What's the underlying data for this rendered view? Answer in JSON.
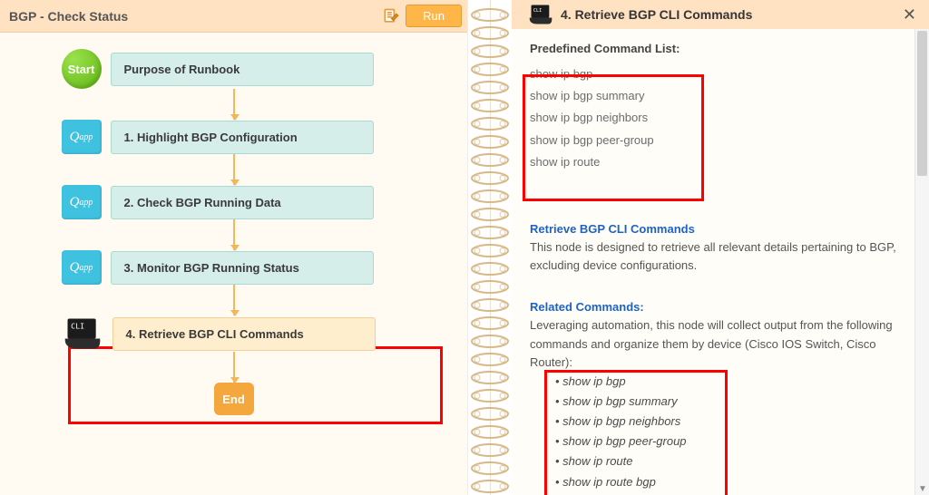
{
  "left": {
    "title": "BGP - Check Status",
    "run_label": "Run",
    "start_label": "Start",
    "end_label": "End",
    "qapp_label": "Q",
    "qapp_sub": "app",
    "nodes": {
      "n0": "Purpose of Runbook",
      "n1": "1. Highlight BGP Configuration",
      "n2": "2. Check BGP Running Data",
      "n3": "3. Monitor BGP Running Status",
      "n4": "4. Retrieve BGP CLI Commands"
    }
  },
  "right": {
    "title": "4. Retrieve BGP CLI Commands",
    "predef_heading": "Predefined Command List:",
    "predef": [
      "show ip bgp",
      "show ip bgp summary",
      "show ip bgp neighbors",
      "show ip bgp peer-group",
      "show ip route"
    ],
    "sec_title": "Retrieve BGP CLI Commands",
    "sec_body": "This node is designed to retrieve all relevant details pertaining to BGP, excluding device configurations.",
    "rel_heading": "Related Commands:",
    "rel_body": "Leveraging automation, this node will collect output from the following commands and organize them by device (Cisco IOS Switch, Cisco Router):",
    "rel_cmds": [
      "show ip bgp",
      "show ip bgp summary",
      "show ip bgp neighbors",
      "show ip bgp peer-group",
      "show ip route",
      "show ip route bgp"
    ]
  }
}
